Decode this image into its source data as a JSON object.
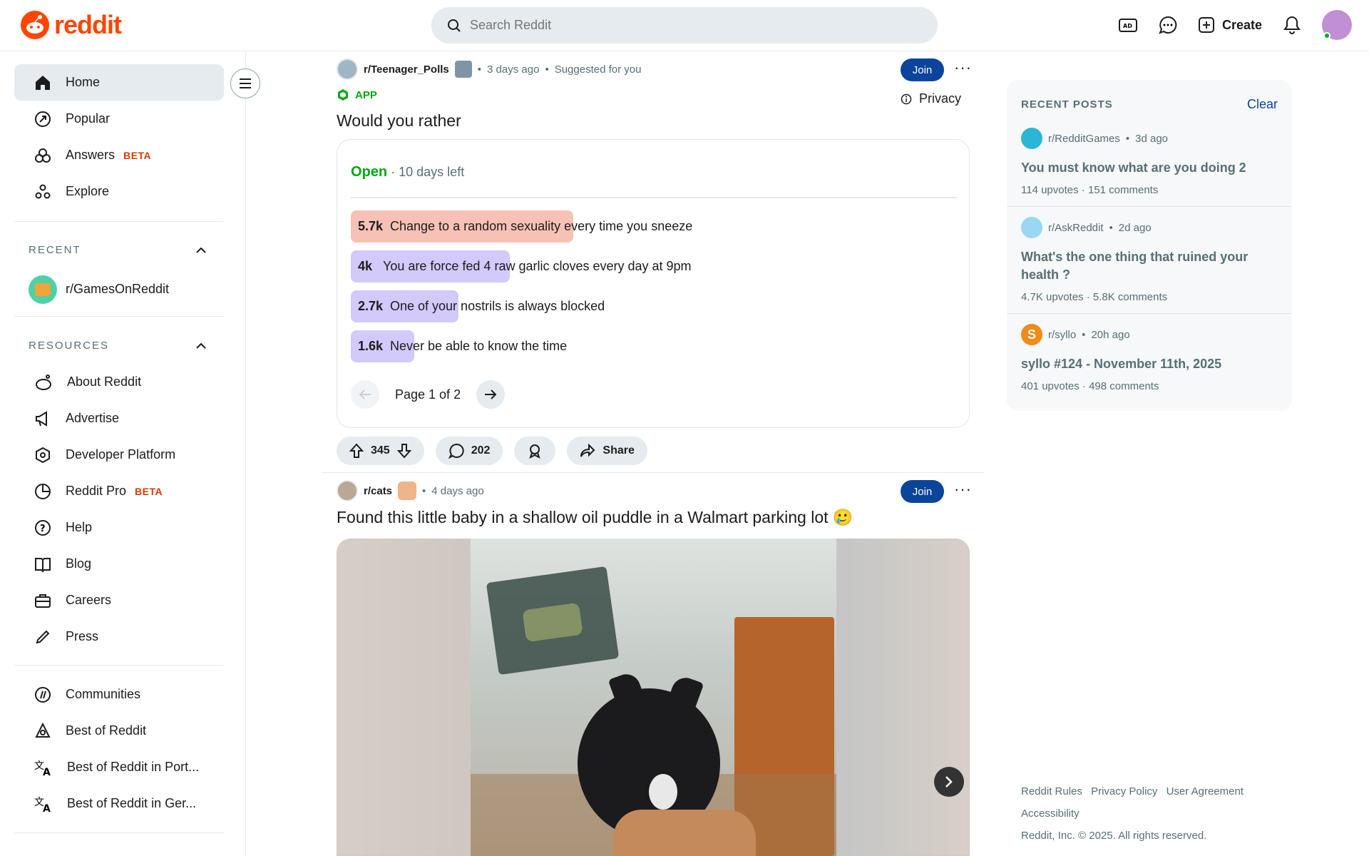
{
  "header": {
    "logo_text": "reddit",
    "search_placeholder": "Search Reddit",
    "create_label": "Create",
    "brand_color": "#ff4500"
  },
  "sidebar": {
    "nav": [
      {
        "label": "Home",
        "icon": "home-icon"
      },
      {
        "label": "Popular",
        "icon": "popular-icon"
      },
      {
        "label": "Answers",
        "icon": "answers-icon",
        "badge": "BETA"
      },
      {
        "label": "Explore",
        "icon": "explore-icon"
      }
    ],
    "recent_header": "RECENT",
    "recent": [
      {
        "label": "r/GamesOnReddit"
      }
    ],
    "resources_header": "RESOURCES",
    "resources": [
      {
        "label": "About Reddit",
        "icon": "about-icon"
      },
      {
        "label": "Advertise",
        "icon": "megaphone-icon"
      },
      {
        "label": "Developer Platform",
        "icon": "developer-icon"
      },
      {
        "label": "Reddit Pro",
        "icon": "pro-icon",
        "badge": "BETA"
      },
      {
        "label": "Help",
        "icon": "help-icon"
      },
      {
        "label": "Blog",
        "icon": "book-icon"
      },
      {
        "label": "Careers",
        "icon": "briefcase-icon"
      },
      {
        "label": "Press",
        "icon": "pen-icon"
      }
    ],
    "more": [
      {
        "label": "Communities",
        "icon": "communities-icon"
      },
      {
        "label": "Best of Reddit",
        "icon": "best-icon"
      },
      {
        "label": "Best of Reddit in Port...",
        "icon": "translate-icon"
      },
      {
        "label": "Best of Reddit in Ger...",
        "icon": "translate-icon"
      }
    ]
  },
  "posts": [
    {
      "subreddit": "r/Teenager_Polls",
      "time": "3 days ago",
      "suggested": "Suggested for you",
      "join_label": "Join",
      "app_label": "APP",
      "privacy_label": "Privacy",
      "title": "Would you rather",
      "poll": {
        "status": "Open",
        "time_left": "10 days left",
        "options": [
          {
            "count": "5.7k",
            "text": "Change to a random sexuality every time you sneeze",
            "share": 0.35,
            "color": "#f7c1b6"
          },
          {
            "count": "4k",
            "text": "You are force fed 4 raw garlic cloves every day at 9pm",
            "share": 0.25,
            "color": "#d3c9fb"
          },
          {
            "count": "2.7k",
            "text": "One of your nostrils is always blocked",
            "share": 0.17,
            "color": "#d3c9fb"
          },
          {
            "count": "1.6k",
            "text": "Never be able to know the time",
            "share": 0.1,
            "color": "#d3c9fb"
          }
        ],
        "page_label": "Page 1 of 2"
      },
      "votes": "345",
      "comments": "202",
      "share_label": "Share"
    },
    {
      "subreddit": "r/cats",
      "time": "4 days ago",
      "join_label": "Join",
      "title": "Found this little baby in a shallow oil puddle in a Walmart parking lot 🥲"
    }
  ],
  "recent_posts": {
    "header": "RECENT POSTS",
    "clear_label": "Clear",
    "items": [
      {
        "subreddit": "r/RedditGames",
        "time": "3d ago",
        "title": "You must know what are you doing 2",
        "upvotes": "114 upvotes",
        "comments": "151 comments",
        "icon_color": "#2bb6d6"
      },
      {
        "subreddit": "r/AskReddit",
        "time": "2d ago",
        "title": "What's the one thing that ruined your health ?",
        "upvotes": "4.7K upvotes",
        "comments": "5.8K comments",
        "icon_color": "#9ad7f2"
      },
      {
        "subreddit": "r/syllo",
        "time": "20h ago",
        "title": "syllo #124 - November 11th, 2025",
        "upvotes": "401 upvotes",
        "comments": "498 comments",
        "icon_color": "#f28a19",
        "icon_letter": "S"
      }
    ]
  },
  "footer": {
    "links": [
      "Reddit Rules",
      "Privacy Policy",
      "User Agreement",
      "Accessibility"
    ],
    "copyright": "Reddit, Inc. © 2025. All rights reserved."
  }
}
